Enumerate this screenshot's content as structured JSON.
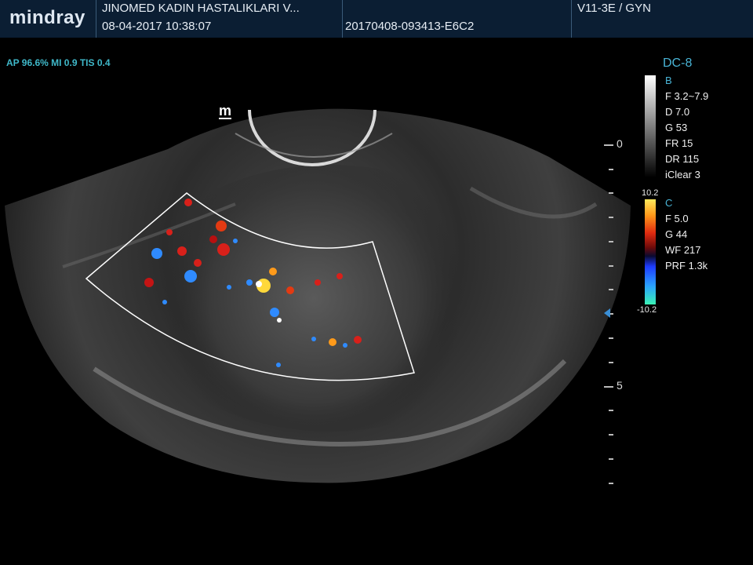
{
  "header": {
    "logo": "mindray",
    "institution": "JINOMED KADIN HASTALIKLARI V...",
    "datetime": "08-04-2017  10:38:07",
    "exam_id": "20170408-093413-E6C2",
    "probe_preset": "V11-3E / GYN"
  },
  "acoustic": {
    "text": "AP 96.6%  MI 0.9  TIS 0.4"
  },
  "mode": {
    "title": "DC-8"
  },
  "b_mode": {
    "label": "B",
    "params": [
      "F 3.2~7.9",
      "D 7.0",
      "G 53",
      "FR 15",
      "DR 115",
      "iClear 3"
    ]
  },
  "color_mode": {
    "label": "C",
    "params": [
      "F 5.0",
      "G 44",
      "WF 217",
      "PRF 1.3k"
    ],
    "scale_max": "10.2",
    "scale_min": "-10.2"
  },
  "depth_scale": {
    "labels": [
      {
        "value": "0",
        "at": 0
      },
      {
        "value": "5",
        "at": 5
      }
    ],
    "max_depth": 7.0
  },
  "marker": {
    "text": "m"
  },
  "colors": {
    "header_bg": "#0b1e33",
    "accent": "#49b4d6",
    "flow_red": "#d8201a",
    "flow_blue": "#2f8bff"
  }
}
